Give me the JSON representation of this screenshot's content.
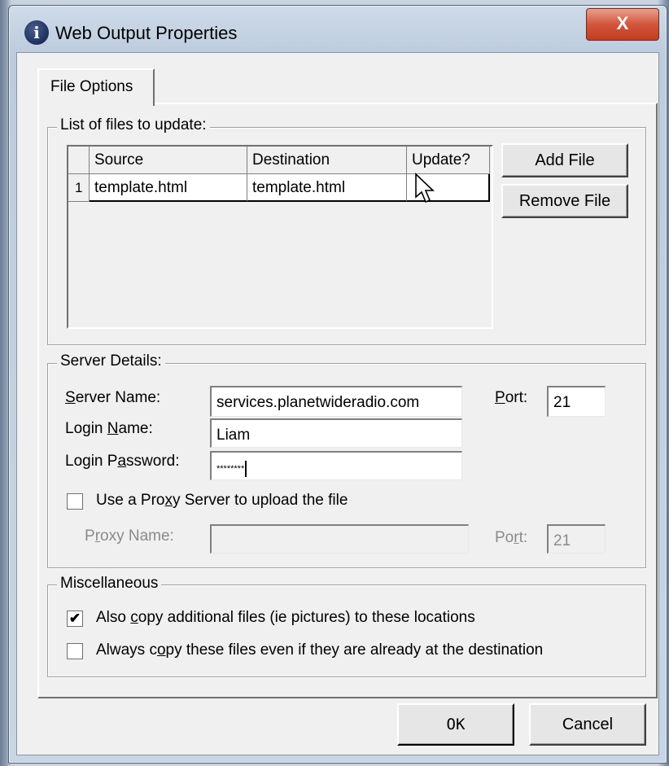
{
  "window": {
    "title": "Web Output Properties",
    "close_glyph": "X"
  },
  "tabs": [
    {
      "label": "File Options"
    }
  ],
  "files_group": {
    "label": "List of files to update:",
    "columns": [
      "Source",
      "Destination",
      "Update?"
    ],
    "rows": [
      {
        "num": "1",
        "source": "template.html",
        "destination": "template.html",
        "update": ""
      }
    ],
    "add_button": "Add File",
    "remove_button": "Remove File"
  },
  "server_group": {
    "label": "Server Details:",
    "server_name_label": {
      "pre": "",
      "key": "S",
      "post": "erver Name:"
    },
    "server_name_value": "services.planetwideradio.com",
    "port_label": {
      "pre": "",
      "key": "P",
      "post": "ort:"
    },
    "port_value": "21",
    "login_name_label": {
      "pre": "Login ",
      "key": "N",
      "post": "ame:"
    },
    "login_name_value": "Liam",
    "login_password_label": {
      "pre": "Login P",
      "key": "a",
      "post": "ssword:"
    },
    "login_password_value": "********",
    "proxy_checkbox_label": {
      "pre": "Use a Pro",
      "key": "x",
      "post": "y Server to upload the file"
    },
    "proxy_checked": false,
    "proxy_name_label": {
      "pre": "P",
      "key": "r",
      "post": "oxy Name:"
    },
    "proxy_name_value": "",
    "proxy_port_label": {
      "pre": "Po",
      "key": "r",
      "post": "t:"
    },
    "proxy_port_value": "21"
  },
  "misc_group": {
    "label": "Miscellaneous",
    "copy_additional_label": {
      "pre": "Also ",
      "key": "c",
      "post": "opy additional files (ie pictures) to these locations"
    },
    "copy_additional_checked": true,
    "always_copy_label": {
      "pre": "Always c",
      "key": "o",
      "post": "py these files even if they are already at the destination"
    },
    "always_copy_checked": false
  },
  "footer": {
    "ok_label": "OK",
    "cancel_label": "Cancel"
  },
  "colors": {
    "title_bar": "#bccbdd",
    "close_button": "#c9462c",
    "dialog_face": "#f0f0f0"
  }
}
